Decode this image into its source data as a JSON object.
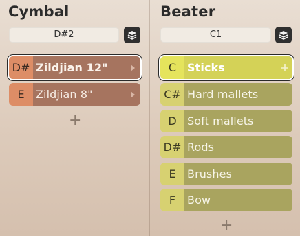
{
  "cymbal": {
    "title": "Cymbal",
    "note": "D#2",
    "items": [
      {
        "key": "D#",
        "label": "Zildjian 12\""
      },
      {
        "key": "E",
        "label": "Zildjian 8\""
      }
    ],
    "add_label": "+"
  },
  "beater": {
    "title": "Beater",
    "note": "C1",
    "items": [
      {
        "key": "C",
        "label": "Sticks"
      },
      {
        "key": "C#",
        "label": "Hard mallets"
      },
      {
        "key": "D",
        "label": "Soft mallets"
      },
      {
        "key": "D#",
        "label": "Rods"
      },
      {
        "key": "E",
        "label": "Brushes"
      },
      {
        "key": "F",
        "label": "Bow"
      }
    ],
    "add_label": "+"
  },
  "colors": {
    "cymbal_key": "#dd8d66",
    "cymbal_row": "#a6745f",
    "beater_key": "#d7d171",
    "beater_row": "#a9a45f",
    "beater_selected": "#d4d257"
  }
}
